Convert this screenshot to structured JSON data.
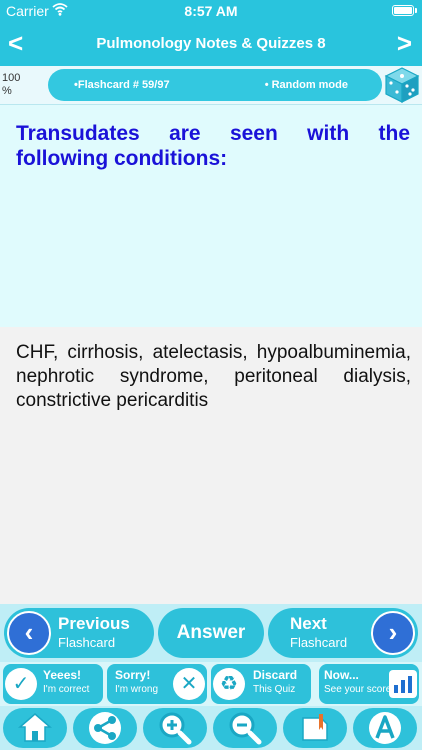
{
  "status_bar": {
    "carrier": "Carrier",
    "time": "8:57 AM"
  },
  "nav": {
    "back": "<",
    "title": "Pulmonology Notes & Quizzes 8",
    "forward": ">"
  },
  "info_bar": {
    "zoom": "100 %",
    "flashcard": "•Flashcard #  59/97",
    "mode": "• Random mode"
  },
  "question": "Transudates are seen with the following conditions:",
  "answer": "CHF, cirrhosis, atelectasis, hypoalbuminemia, nephrotic syndrome, peritoneal dialysis, constrictive pericarditis",
  "controls": {
    "previous": {
      "line1": "Previous",
      "line2": "Flashcard"
    },
    "answer_label": "Answer",
    "next": {
      "line1": "Next",
      "line2": "Flashcard"
    }
  },
  "quiz_buttons": {
    "correct": {
      "line1": "Yeees!",
      "line2": "I'm correct"
    },
    "wrong": {
      "line1": "Sorry!",
      "line2": "I'm wrong"
    },
    "discard": {
      "line1": "Discard",
      "line2": "This Quiz"
    },
    "score": {
      "line1": "Now...",
      "line2": "See your score"
    }
  },
  "toolbar_icons": [
    "home-icon",
    "share-icon",
    "zoom-in-icon",
    "zoom-out-icon",
    "bookmark-icon",
    "font-icon"
  ],
  "colors": {
    "primary": "#29c4dd",
    "question_text": "#1a12d8",
    "nav_circle": "#2f6fd6"
  }
}
